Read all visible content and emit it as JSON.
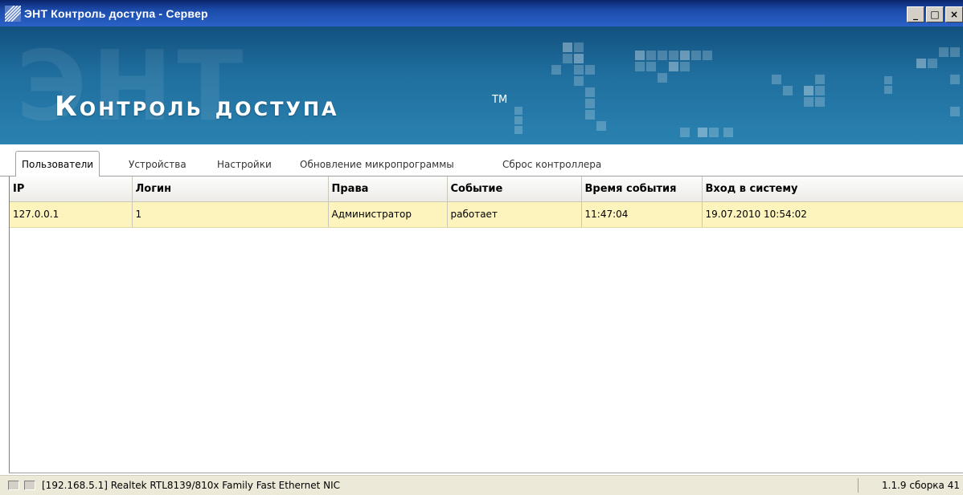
{
  "window": {
    "title": "ЭНТ Контроль доступа - Сервер",
    "controls": {
      "minimize": "_",
      "maximize": "□",
      "close": "×"
    }
  },
  "banner": {
    "title": "Контроль доступа",
    "trademark": "TM",
    "watermark": "ЭНТ"
  },
  "tabs": [
    {
      "label": "Пользователи",
      "active": true
    },
    {
      "label": "Устройства",
      "active": false
    },
    {
      "label": "Настройки",
      "active": false
    },
    {
      "label": "Обновление микропрограммы",
      "active": false
    },
    {
      "label": "Сброс контроллера",
      "active": false
    }
  ],
  "table": {
    "columns": [
      "IP",
      "Логин",
      "Права",
      "Событие",
      "Время события",
      "Вход в систему"
    ],
    "rows": [
      [
        "127.0.0.1",
        "1",
        "Администратор",
        "работает",
        "11:47:04",
        "19.07.2010 10:54:02"
      ]
    ],
    "selected_row_color": "#fdf3bd"
  },
  "statusbar": {
    "network": "[192.168.5.1] Realtek RTL8139/810x Family Fast Ethernet NIC",
    "version": "1.1.9 сборка 41"
  },
  "icons": {
    "app": "app-logo-icon",
    "led1": "status-led-icon",
    "led2": "status-led-icon"
  },
  "colors": {
    "titlebar": "#0a246a",
    "banner": "#1f6e9e",
    "row_highlight": "#fdf3bd"
  }
}
